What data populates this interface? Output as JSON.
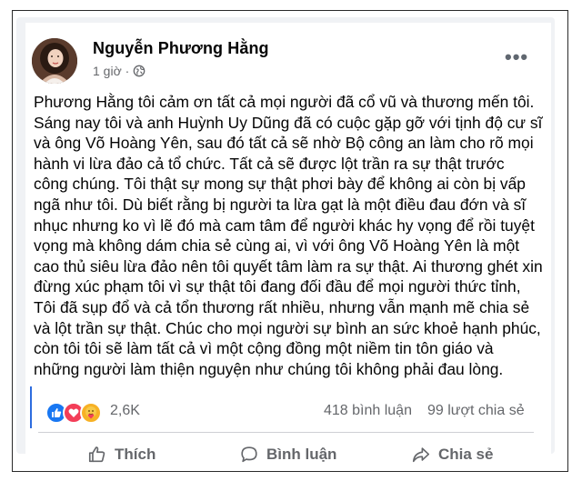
{
  "post": {
    "author": "Nguyễn Phương Hằng",
    "time": "1 giờ ·",
    "more_label": "•••",
    "body": "Phương Hằng tôi cảm ơn tất cả mọi người đã cổ vũ và thương mến tôi. Sáng nay tôi và anh Huỳnh Uy Dũng đã có cuộc gặp gỡ với tịnh độ cư sĩ và ông Võ Hoàng Yên, sau đó tất cả sẽ nhờ Bộ công an làm cho rõ mọi hành vi lừa đảo cả tổ chức. Tất cả sẽ được lột trần ra sự thật trước công chúng. Tôi thật sự mong sự thật phơi bày để không ai còn bị vấp ngã như tôi. Dù biết rằng bị người ta lừa gạt là một điều đau đớn và sĩ nhục nhưng ko vì lẽ đó mà cam tâm để người khác hy vọng để rồi tuyệt vọng mà không dám chia sẻ cùng ai, vì với ông Võ Hoàng Yên là một cao thủ siêu lừa đảo nên tôi quyết tâm làm ra sự thật. Ai thương ghét xin đừng xúc phạm tôi vì sự thật tôi đang đối đầu để mọi người thức tỉnh, Tôi đã sụp đổ và cả tổn thương rất nhiều, nhưng vẫn mạnh mẽ chia sẻ và lột trần sự thật. Chúc cho mọi người sự bình an sức khoẻ hạnh phúc, còn tôi tôi sẽ làm tất cả vì một cộng đồng một niềm tin tôn giáo và những người làm thiện nguyện như chúng tôi không phải đau lòng."
  },
  "stats": {
    "reaction_icons": [
      "like-icon",
      "love-icon",
      "care-icon"
    ],
    "reactions": "2,6K",
    "comments": "418 bình luận",
    "shares": "99 lượt chia sẻ"
  },
  "actions": {
    "like_label": "Thích",
    "comment_label": "Bình luận",
    "share_label": "Chia sẻ"
  },
  "colors": {
    "like_blue": "#1877f2",
    "love_red": "#f33e58",
    "care_yellow": "#f7b125",
    "secondary_text": "#65676b"
  }
}
